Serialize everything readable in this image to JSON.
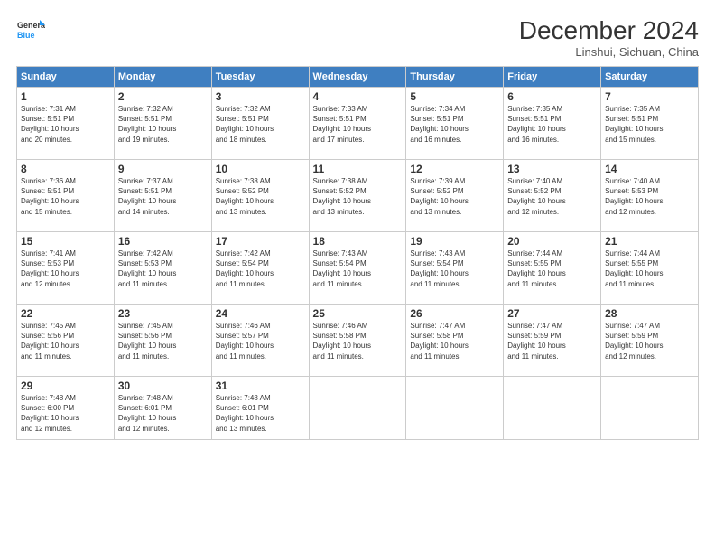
{
  "header": {
    "logo_text_general": "General",
    "logo_text_blue": "Blue",
    "month": "December 2024",
    "location": "Linshui, Sichuan, China"
  },
  "weekdays": [
    "Sunday",
    "Monday",
    "Tuesday",
    "Wednesday",
    "Thursday",
    "Friday",
    "Saturday"
  ],
  "weeks": [
    [
      {
        "day": "1",
        "info": "Sunrise: 7:31 AM\nSunset: 5:51 PM\nDaylight: 10 hours\nand 20 minutes."
      },
      {
        "day": "2",
        "info": "Sunrise: 7:32 AM\nSunset: 5:51 PM\nDaylight: 10 hours\nand 19 minutes."
      },
      {
        "day": "3",
        "info": "Sunrise: 7:32 AM\nSunset: 5:51 PM\nDaylight: 10 hours\nand 18 minutes."
      },
      {
        "day": "4",
        "info": "Sunrise: 7:33 AM\nSunset: 5:51 PM\nDaylight: 10 hours\nand 17 minutes."
      },
      {
        "day": "5",
        "info": "Sunrise: 7:34 AM\nSunset: 5:51 PM\nDaylight: 10 hours\nand 16 minutes."
      },
      {
        "day": "6",
        "info": "Sunrise: 7:35 AM\nSunset: 5:51 PM\nDaylight: 10 hours\nand 16 minutes."
      },
      {
        "day": "7",
        "info": "Sunrise: 7:35 AM\nSunset: 5:51 PM\nDaylight: 10 hours\nand 15 minutes."
      }
    ],
    [
      {
        "day": "8",
        "info": "Sunrise: 7:36 AM\nSunset: 5:51 PM\nDaylight: 10 hours\nand 15 minutes."
      },
      {
        "day": "9",
        "info": "Sunrise: 7:37 AM\nSunset: 5:51 PM\nDaylight: 10 hours\nand 14 minutes."
      },
      {
        "day": "10",
        "info": "Sunrise: 7:38 AM\nSunset: 5:52 PM\nDaylight: 10 hours\nand 13 minutes."
      },
      {
        "day": "11",
        "info": "Sunrise: 7:38 AM\nSunset: 5:52 PM\nDaylight: 10 hours\nand 13 minutes."
      },
      {
        "day": "12",
        "info": "Sunrise: 7:39 AM\nSunset: 5:52 PM\nDaylight: 10 hours\nand 13 minutes."
      },
      {
        "day": "13",
        "info": "Sunrise: 7:40 AM\nSunset: 5:52 PM\nDaylight: 10 hours\nand 12 minutes."
      },
      {
        "day": "14",
        "info": "Sunrise: 7:40 AM\nSunset: 5:53 PM\nDaylight: 10 hours\nand 12 minutes."
      }
    ],
    [
      {
        "day": "15",
        "info": "Sunrise: 7:41 AM\nSunset: 5:53 PM\nDaylight: 10 hours\nand 12 minutes."
      },
      {
        "day": "16",
        "info": "Sunrise: 7:42 AM\nSunset: 5:53 PM\nDaylight: 10 hours\nand 11 minutes."
      },
      {
        "day": "17",
        "info": "Sunrise: 7:42 AM\nSunset: 5:54 PM\nDaylight: 10 hours\nand 11 minutes."
      },
      {
        "day": "18",
        "info": "Sunrise: 7:43 AM\nSunset: 5:54 PM\nDaylight: 10 hours\nand 11 minutes."
      },
      {
        "day": "19",
        "info": "Sunrise: 7:43 AM\nSunset: 5:54 PM\nDaylight: 10 hours\nand 11 minutes."
      },
      {
        "day": "20",
        "info": "Sunrise: 7:44 AM\nSunset: 5:55 PM\nDaylight: 10 hours\nand 11 minutes."
      },
      {
        "day": "21",
        "info": "Sunrise: 7:44 AM\nSunset: 5:55 PM\nDaylight: 10 hours\nand 11 minutes."
      }
    ],
    [
      {
        "day": "22",
        "info": "Sunrise: 7:45 AM\nSunset: 5:56 PM\nDaylight: 10 hours\nand 11 minutes."
      },
      {
        "day": "23",
        "info": "Sunrise: 7:45 AM\nSunset: 5:56 PM\nDaylight: 10 hours\nand 11 minutes."
      },
      {
        "day": "24",
        "info": "Sunrise: 7:46 AM\nSunset: 5:57 PM\nDaylight: 10 hours\nand 11 minutes."
      },
      {
        "day": "25",
        "info": "Sunrise: 7:46 AM\nSunset: 5:58 PM\nDaylight: 10 hours\nand 11 minutes."
      },
      {
        "day": "26",
        "info": "Sunrise: 7:47 AM\nSunset: 5:58 PM\nDaylight: 10 hours\nand 11 minutes."
      },
      {
        "day": "27",
        "info": "Sunrise: 7:47 AM\nSunset: 5:59 PM\nDaylight: 10 hours\nand 11 minutes."
      },
      {
        "day": "28",
        "info": "Sunrise: 7:47 AM\nSunset: 5:59 PM\nDaylight: 10 hours\nand 12 minutes."
      }
    ],
    [
      {
        "day": "29",
        "info": "Sunrise: 7:48 AM\nSunset: 6:00 PM\nDaylight: 10 hours\nand 12 minutes."
      },
      {
        "day": "30",
        "info": "Sunrise: 7:48 AM\nSunset: 6:01 PM\nDaylight: 10 hours\nand 12 minutes."
      },
      {
        "day": "31",
        "info": "Sunrise: 7:48 AM\nSunset: 6:01 PM\nDaylight: 10 hours\nand 13 minutes."
      },
      {
        "day": "",
        "info": ""
      },
      {
        "day": "",
        "info": ""
      },
      {
        "day": "",
        "info": ""
      },
      {
        "day": "",
        "info": ""
      }
    ]
  ]
}
